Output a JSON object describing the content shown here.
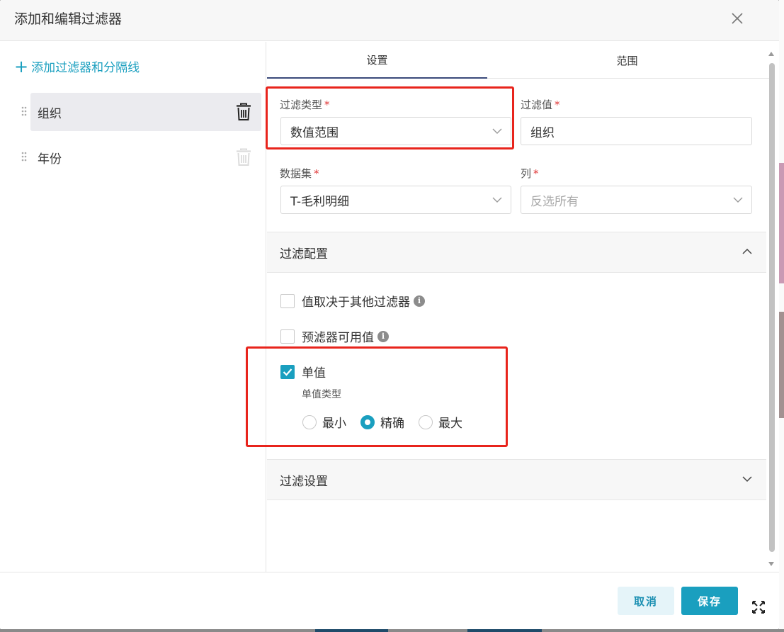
{
  "dialog": {
    "title": "添加和编辑过滤器"
  },
  "left": {
    "add_label": "添加过滤器和分隔线",
    "items": [
      {
        "label": "组织",
        "active": true
      },
      {
        "label": "年份",
        "active": false
      }
    ]
  },
  "tabs": [
    {
      "label": "设置",
      "active": true
    },
    {
      "label": "范围",
      "active": false
    }
  ],
  "settings": {
    "filter_type": {
      "label": "过滤类型",
      "required": "*",
      "value": "数值范围"
    },
    "filter_value": {
      "label": "过滤值",
      "required": "*",
      "value": "组织"
    },
    "dataset": {
      "label": "数据集",
      "required": "*",
      "value": "T-毛利明细"
    },
    "column": {
      "label": "列",
      "required": "*",
      "placeholder": "反选所有"
    }
  },
  "filter_config": {
    "title": "过滤配置",
    "expanded": true,
    "depends_label": "值取决于其他过滤器",
    "prefilter_label": "预滤器可用值",
    "single_label": "单值",
    "single_checked": true,
    "single_type_label": "单值类型",
    "options": [
      {
        "label": "最小",
        "checked": false
      },
      {
        "label": "精确",
        "checked": true
      },
      {
        "label": "最大",
        "checked": false
      }
    ]
  },
  "filter_settings": {
    "title": "过滤设置",
    "expanded": false
  },
  "footer": {
    "cancel_label": "取消",
    "save_label": "保存"
  },
  "colors": {
    "accent": "#1a9fbf",
    "highlight": "#e8241c",
    "required": "#e03a3a"
  }
}
